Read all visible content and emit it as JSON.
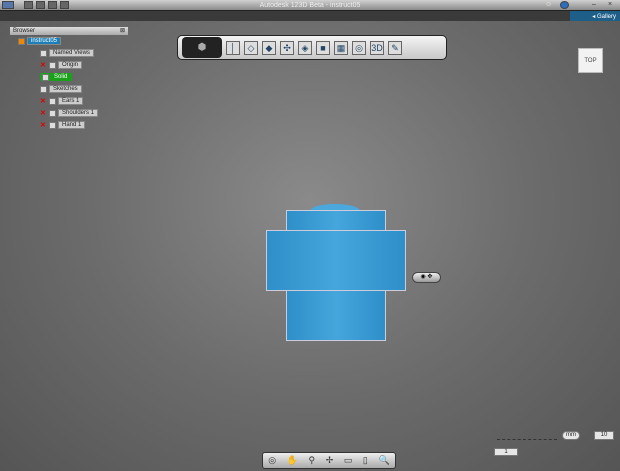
{
  "window": {
    "title": "Autodesk 123D Beta - instruct05"
  },
  "ribbon": {
    "gallery_label": "Gallery"
  },
  "browser": {
    "title": "Browser",
    "nodes": [
      {
        "label": "instruct05"
      },
      {
        "label": "Named Views"
      },
      {
        "label": "Origin"
      },
      {
        "label": "Solid"
      },
      {
        "label": "Sketches"
      },
      {
        "label": "Ears 1"
      },
      {
        "label": "Shoulders 1"
      },
      {
        "label": "Hand 1"
      }
    ]
  },
  "viewcube": {
    "face": "TOP"
  },
  "scale": {
    "unit": "mm",
    "value": "10",
    "marker": "1"
  },
  "colors": {
    "body": "#3a9bd5",
    "active": "#1aa01a",
    "selected": "#1d7fb8"
  }
}
